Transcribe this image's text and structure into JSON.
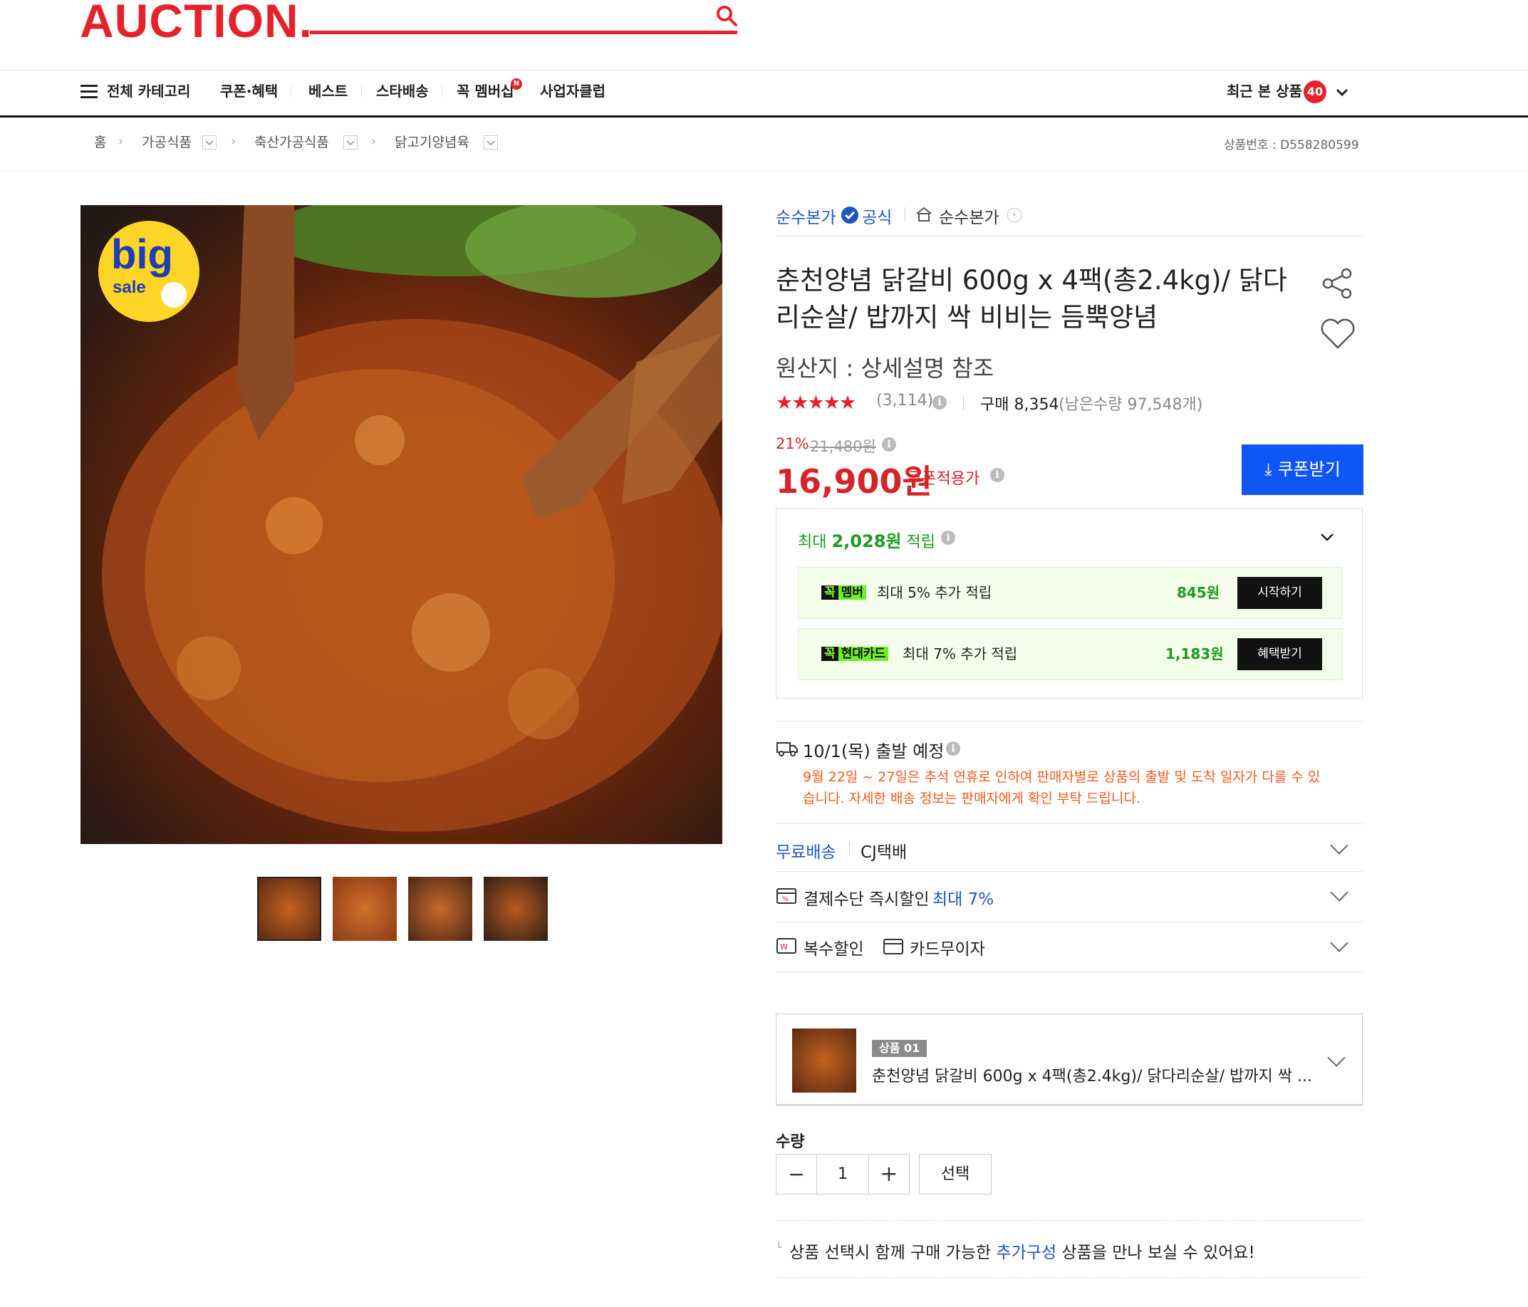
{
  "header": {
    "logo": "AUCTION.",
    "search_icon": "search-icon"
  },
  "nav": {
    "all_categories": "전체 카테고리",
    "items": [
      "쿠폰·혜택",
      "베스트",
      "스타배송",
      "꼭 멤버십",
      "사업자클럽"
    ],
    "new_badge": "N",
    "recent_label": "최근 본 상품",
    "recent_count": "40"
  },
  "breadcrumb": {
    "home": "홈",
    "levels": [
      "가공식품",
      "축산가공식품",
      "닭고기양념육"
    ],
    "product_no": "상품번호 : D558280599"
  },
  "gallery": {
    "badge_big": "big",
    "badge_sale": "sale",
    "thumbnail_count": 4
  },
  "seller": {
    "name": "순수본가",
    "official": "공식",
    "shop": "순수본가"
  },
  "product": {
    "title": "춘천양념 닭갈비 600g x 4팩(총2.4kg)/ 닭다리순살/ 밥까지 싹 비비는 듬뿍양념",
    "origin": "원산지 : 상세설명 참조",
    "rating_stars": "★★★★★",
    "review_count": "(3,114)",
    "purchase": "구매 8,354",
    "remaining": "(남은수량 97,548개)",
    "rating": 4.5
  },
  "pricing": {
    "discount_rate": "21%",
    "original_price": "21,480원",
    "sale_price": "16,900원",
    "coupon_label": "쿠폰적용가",
    "coupon_button": "쿠폰받기"
  },
  "rewards": {
    "summary_prefix": "최대 ",
    "summary_amount": "2,028원",
    "summary_suffix": " 적립",
    "rows": [
      {
        "tag1": "꼭",
        "tag2": "멤버",
        "text": "최대 5% 추가 적립",
        "amount": "845원",
        "button": "시작하기"
      },
      {
        "tag1": "꼭",
        "tag2": "현대카드",
        "text": "최대 7% 추가 적립",
        "amount": "1,183원",
        "button": "혜택받기"
      }
    ]
  },
  "shipping": {
    "departure": "10/1(목) 출발 예정",
    "notice": "9월 22일 ~ 27일은 추석 연휴로 인하여 판매자별로 상품의 출발 및 도착 일자가 다를 수 있습니다. 자세한 배송 정보는 판매자에게 확인 부탁 드립니다.",
    "free": "무료배송",
    "courier": "CJ택배",
    "payment_discount": "결제수단 즉시할인",
    "payment_max": "최대 7%",
    "multi_discount": "복수할인",
    "card_installment": "카드무이자"
  },
  "option": {
    "tag": "상품 01",
    "name": "춘천양념 닭갈비 600g x 4팩(총2.4kg)/ 닭다리순살/ 밥까지 싹 ..."
  },
  "quantity": {
    "label": "수량",
    "value": "1",
    "minus": "−",
    "plus": "+",
    "select_button": "선택"
  },
  "addon_notice": {
    "prefix": "상품 선택시 함께 구매 가능한 ",
    "link": "추가구성",
    "suffix": " 상품을 만나 보실 수 있어요!"
  },
  "colors": {
    "brand_red": "#e5222c",
    "price_red": "#d8232a",
    "link_blue": "#1d55c4",
    "coupon_blue": "#0f56f5",
    "reward_green": "#1c9b20"
  }
}
